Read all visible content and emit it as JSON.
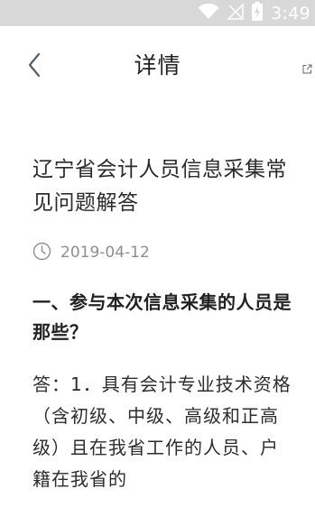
{
  "status_bar": {
    "time": "3:49",
    "icons": [
      "wifi-icon",
      "no-signal-icon",
      "battery-charging-icon"
    ]
  },
  "header": {
    "title": "详情",
    "back_icon": "chevron-left-icon",
    "share_icon": "share-icon"
  },
  "article": {
    "title": "辽宁省会计人员信息采集常见问题解答",
    "date": "2019-04-12",
    "date_icon": "clock-icon",
    "question": "一、参与本次信息采集的人员是那些？",
    "answer": "答：1．具有会计专业技术资格（含初级、中级、高级和正高级）且在我省工作的人员、户籍在我省的"
  },
  "colors": {
    "status_bar_bg": "#d8d8d8",
    "text_primary": "#222222",
    "text_meta": "#8f8f8f",
    "icon_color": "#555f6b"
  }
}
